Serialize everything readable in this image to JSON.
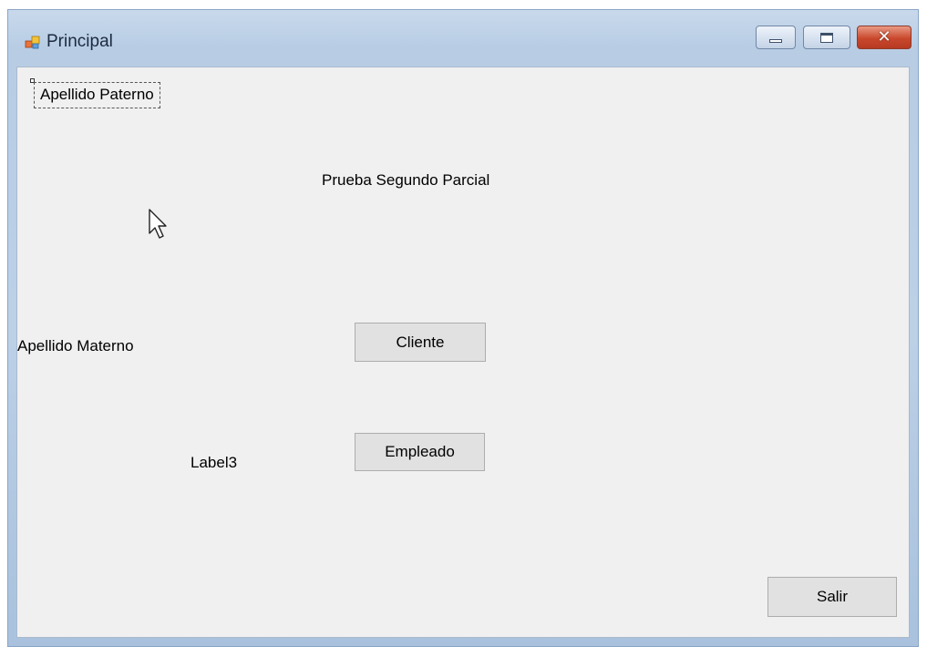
{
  "window": {
    "title": "Principal",
    "icon": "winforms-app-icon",
    "controls": [
      "minimize",
      "maximize",
      "close"
    ],
    "close_glyph": "✕",
    "colors": {
      "titlebar": "#bcd0e6",
      "close_button": "#c9482c",
      "client_background": "#f0f0f0",
      "button_background": "#e1e1e1"
    }
  },
  "form": {
    "label_paterno": "Apellido Paterno",
    "title_label": "Prueba Segundo Parcial",
    "label_materno": "Apellido Materno",
    "label3": "Label3",
    "buttons": {
      "cliente": "Cliente",
      "empleado": "Empleado",
      "salir": "Salir"
    }
  },
  "cursor": "arrow-pointer-icon"
}
